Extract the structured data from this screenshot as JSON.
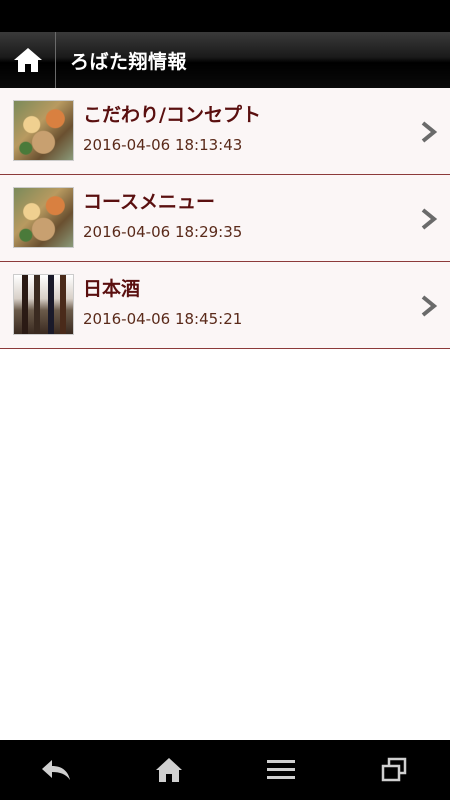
{
  "header": {
    "title": "ろばた翔情報",
    "home_icon": "home-icon"
  },
  "list": [
    {
      "title": "こだわり/コンセプト",
      "date": "2016-04-06 18:13:43",
      "thumbnail": "food-photo"
    },
    {
      "title": "コースメニュー",
      "date": "2016-04-06 18:29:35",
      "thumbnail": "food-photo"
    },
    {
      "title": "日本酒",
      "date": "2016-04-06 18:45:21",
      "thumbnail": "sake-bottles-photo"
    }
  ],
  "nav": {
    "icons": [
      "back-icon",
      "home-icon",
      "menu-icon",
      "recent-apps-icon"
    ]
  },
  "colors": {
    "title_text": "#5a0f0f",
    "item_bg": "#fbf6f6",
    "divider": "#8c3a3a"
  }
}
